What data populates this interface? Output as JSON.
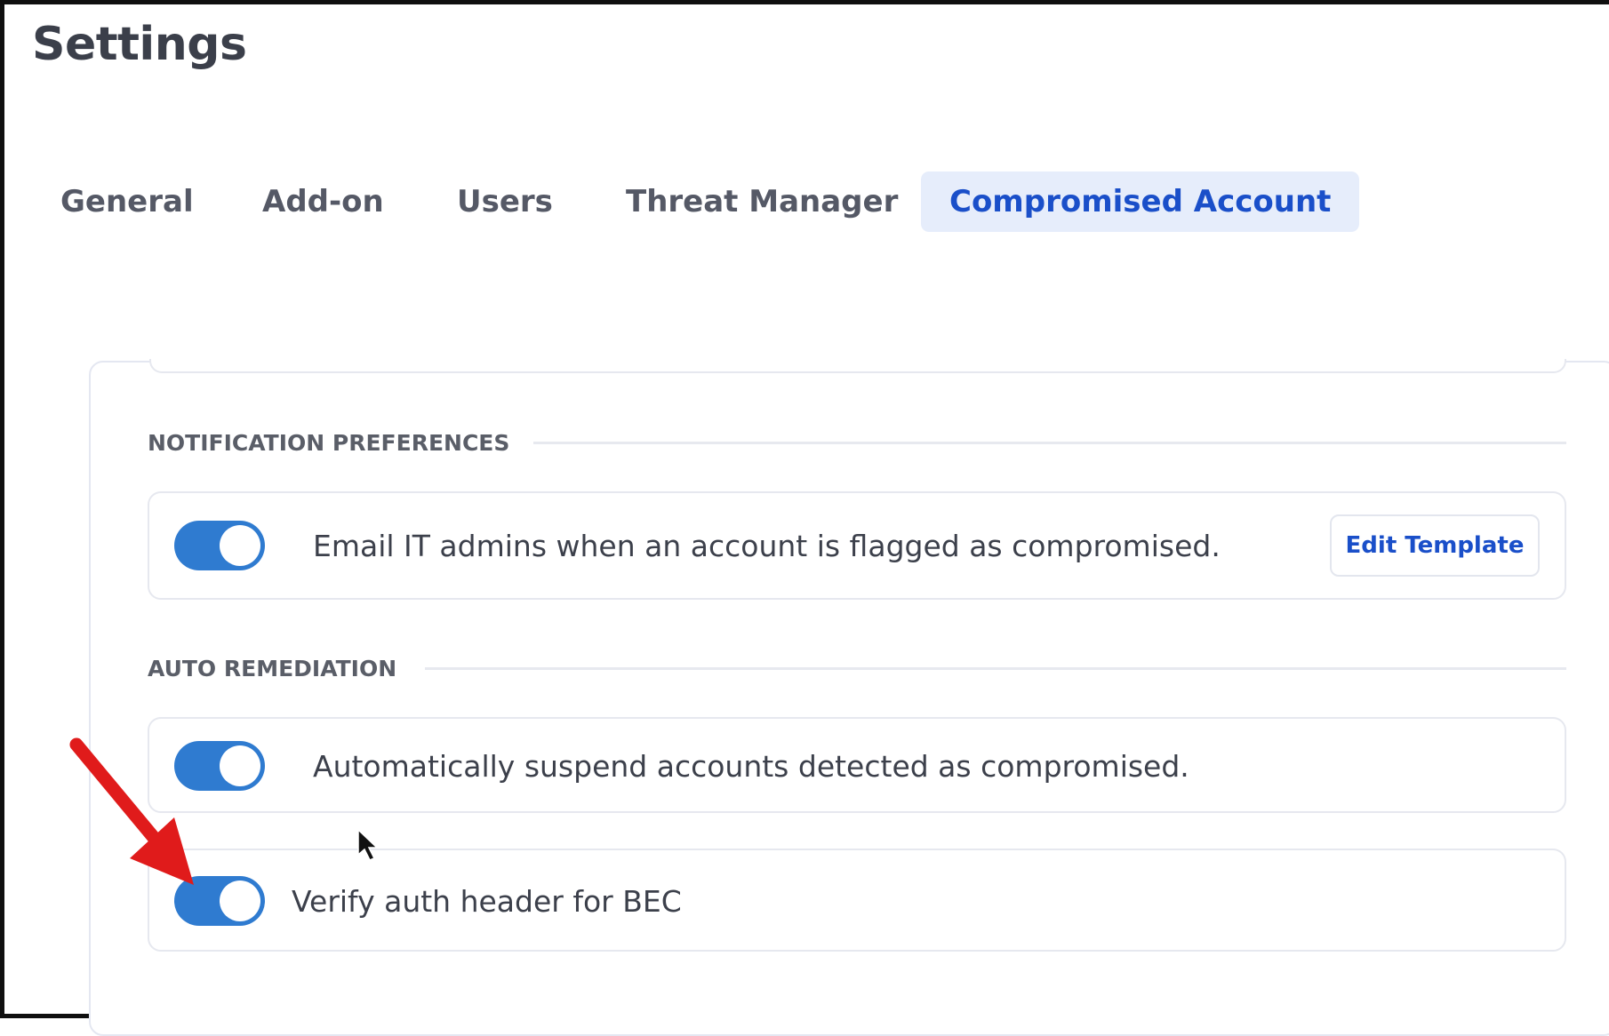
{
  "page": {
    "title": "Settings"
  },
  "tabs": [
    {
      "label": "General"
    },
    {
      "label": "Add-on"
    },
    {
      "label": "Users"
    },
    {
      "label": "Threat Manager"
    },
    {
      "label": "Compromised Account",
      "active": true
    }
  ],
  "sections": {
    "notification": {
      "heading": "NOTIFICATION PREFERENCES",
      "rows": [
        {
          "label": "Email IT admins when an account is flagged as compromised.",
          "enabled": true,
          "action_label": "Edit Template"
        }
      ]
    },
    "auto_remediation": {
      "heading": "AUTO REMEDIATION",
      "rows": [
        {
          "label": "Automatically suspend accounts detected as compromised.",
          "enabled": true
        },
        {
          "label": "Verify auth header for BEC",
          "enabled": true
        }
      ]
    }
  },
  "colors": {
    "accent": "#2f7bd0",
    "active_tab_bg": "#e6edfb",
    "active_tab_text": "#1a4fc9",
    "annotation_arrow": "#e01b1b"
  },
  "annotation": {
    "icon": "red-arrow-icon",
    "cursor_icon": "mouse-pointer-icon"
  }
}
